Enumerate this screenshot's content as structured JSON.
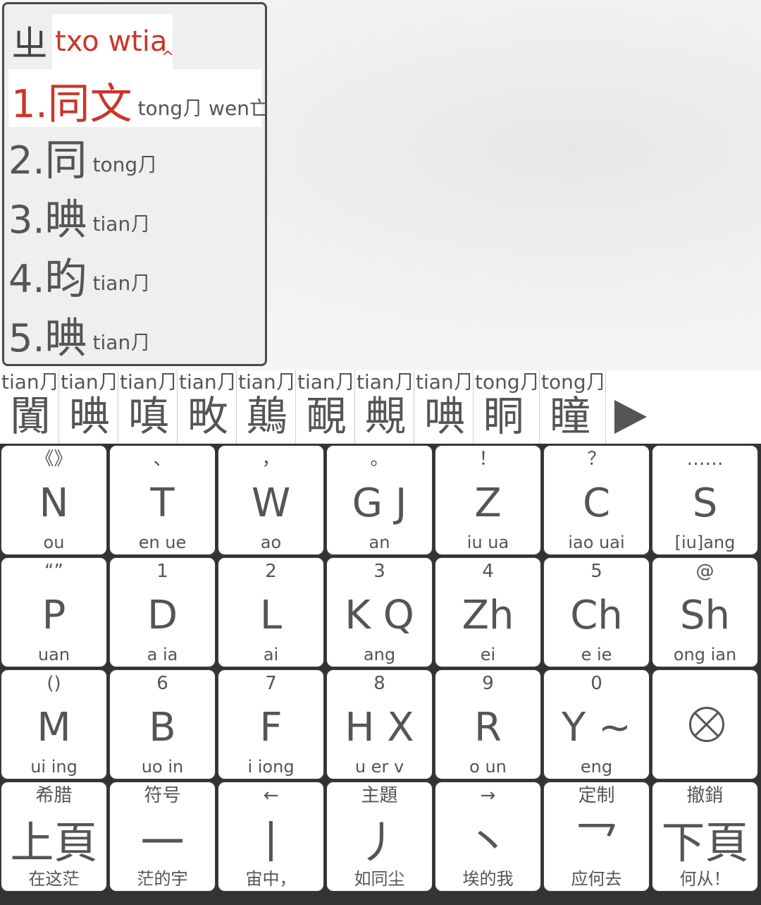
{
  "composition": {
    "root": "ㄓ",
    "code": "txo wtia",
    "caret": "^"
  },
  "candidates": [
    {
      "num": "1.",
      "text": "同文",
      "pinyin": "tong⺆ wen亡",
      "selected": true
    },
    {
      "num": "2.",
      "text": "同",
      "pinyin": "tong⺆"
    },
    {
      "num": "3.",
      "text": "晪",
      "pinyin": "tian⺆"
    },
    {
      "num": "4.",
      "text": "昀",
      "pinyin": "tian⺆"
    },
    {
      "num": "5.",
      "text": "晪",
      "pinyin": "tian⺆"
    }
  ],
  "candidate_bar": [
    {
      "pinyin": "tian⺆",
      "text": "闐"
    },
    {
      "pinyin": "tian⺆",
      "text": "晪"
    },
    {
      "pinyin": "tian⺆",
      "text": "嗔"
    },
    {
      "pinyin": "tian⺆",
      "text": "畋"
    },
    {
      "pinyin": "tian⺆",
      "text": "鷏"
    },
    {
      "pinyin": "tian⺆",
      "text": "靦"
    },
    {
      "pinyin": "tian⺆",
      "text": "覥"
    },
    {
      "pinyin": "tian⺆",
      "text": "唺"
    },
    {
      "pinyin": "tong⺆",
      "text": "眮"
    },
    {
      "pinyin": "tong⺆",
      "text": "瞳"
    }
  ],
  "keyboard": {
    "rows": [
      [
        {
          "top": "《》",
          "main": "N",
          "bot": "ou"
        },
        {
          "top": "、",
          "main": "T",
          "bot": "en ue"
        },
        {
          "top": "，",
          "main": "W",
          "bot": "ao"
        },
        {
          "top": "。",
          "main": "G J",
          "bot": "an"
        },
        {
          "top": "！",
          "main": "Z",
          "bot": "iu ua"
        },
        {
          "top": "？",
          "main": "C",
          "bot": "iao uai"
        },
        {
          "top": "……",
          "main": "S",
          "bot": "[iu]ang"
        }
      ],
      [
        {
          "top": "“”",
          "main": "P",
          "bot": "uan"
        },
        {
          "top": "1",
          "main": "D",
          "bot": "a ia"
        },
        {
          "top": "2",
          "main": "L",
          "bot": "ai"
        },
        {
          "top": "3",
          "main": "K Q",
          "bot": "ang"
        },
        {
          "top": "4",
          "main": "Zh",
          "bot": "ei"
        },
        {
          "top": "5",
          "main": "Ch",
          "bot": "e ie"
        },
        {
          "top": "@",
          "main": "Sh",
          "bot": "ong ian"
        }
      ],
      [
        {
          "top": "()",
          "main": "M",
          "bot": "ui ing"
        },
        {
          "top": "6",
          "main": "B",
          "bot": "uo in"
        },
        {
          "top": "7",
          "main": "F",
          "bot": "i iong"
        },
        {
          "top": "8",
          "main": "H X",
          "bot": "u er v"
        },
        {
          "top": "9",
          "main": "R",
          "bot": "o un"
        },
        {
          "top": "0",
          "main": "Y ~",
          "bot": "eng"
        },
        {
          "top": "",
          "main": "",
          "bot": "",
          "icon": "delete-circle-x-icon"
        }
      ],
      [
        {
          "top": "希腊",
          "main": "上頁",
          "bot": "在这茫"
        },
        {
          "top": "符号",
          "main": "一",
          "bot": "茫的宇"
        },
        {
          "top": "←",
          "main": "丨",
          "bot": "宙中，"
        },
        {
          "top": "主題",
          "main": "丿",
          "bot": "如同尘"
        },
        {
          "top": "→",
          "main": "丶",
          "bot": "埃的我"
        },
        {
          "top": "定制",
          "main": "乛",
          "bot": "应何去"
        },
        {
          "top": "撤銷",
          "main": "下頁",
          "bot": "何从！"
        }
      ]
    ]
  },
  "icons": {
    "more": "play-triangle-icon",
    "delete": "delete-circle-x-icon"
  },
  "colors": {
    "accent": "#c9362a",
    "text": "#555555",
    "key_bg": "#ffffff",
    "keyboard_bg": "#333333"
  }
}
